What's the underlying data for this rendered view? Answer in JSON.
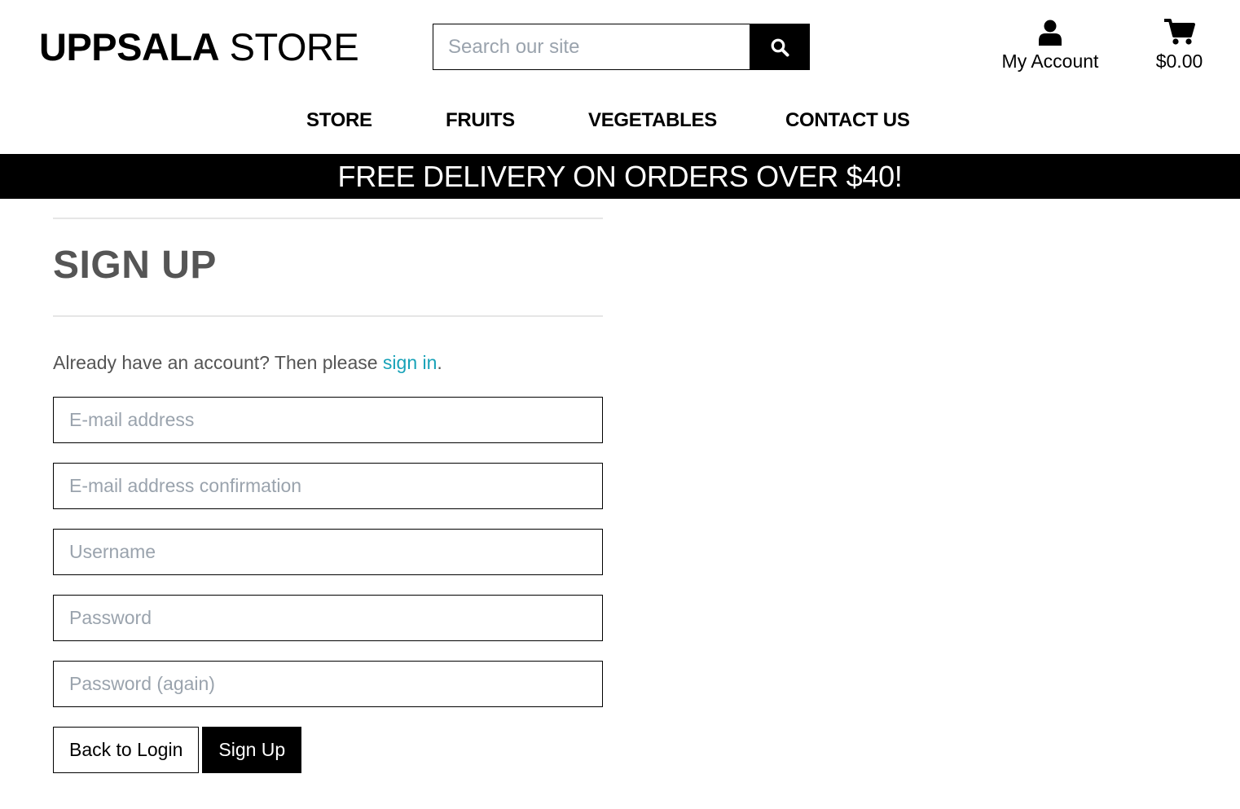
{
  "header": {
    "logo_bold": "UPPSALA",
    "logo_light": "STORE",
    "search": {
      "placeholder": "Search our site",
      "button_icon": "search-icon"
    },
    "account": {
      "icon": "user-icon",
      "label": "My Account"
    },
    "cart": {
      "icon": "shopping-cart-icon",
      "total": "$0.00"
    }
  },
  "nav": {
    "items": [
      {
        "label": "STORE"
      },
      {
        "label": "FRUITS"
      },
      {
        "label": "VEGETABLES"
      },
      {
        "label": "CONTACT US"
      }
    ]
  },
  "banner": {
    "text": "FREE DELIVERY ON ORDERS OVER $40!"
  },
  "signup": {
    "title": "SIGN UP",
    "intro_prefix": "Already have an account? Then please ",
    "intro_link": "sign in",
    "intro_suffix": ".",
    "fields": {
      "email": {
        "placeholder": "E-mail address",
        "value": ""
      },
      "email_confirm": {
        "placeholder": "E-mail address confirmation",
        "value": ""
      },
      "username": {
        "placeholder": "Username",
        "value": ""
      },
      "password": {
        "placeholder": "Password",
        "value": ""
      },
      "password_again": {
        "placeholder": "Password (again)",
        "value": ""
      }
    },
    "back_button": "Back to Login",
    "submit_button": "Sign Up"
  },
  "colors": {
    "banner_bg": "#000000",
    "link": "#17a2b8",
    "placeholder": "#9aa3ad",
    "heading": "#555555"
  }
}
